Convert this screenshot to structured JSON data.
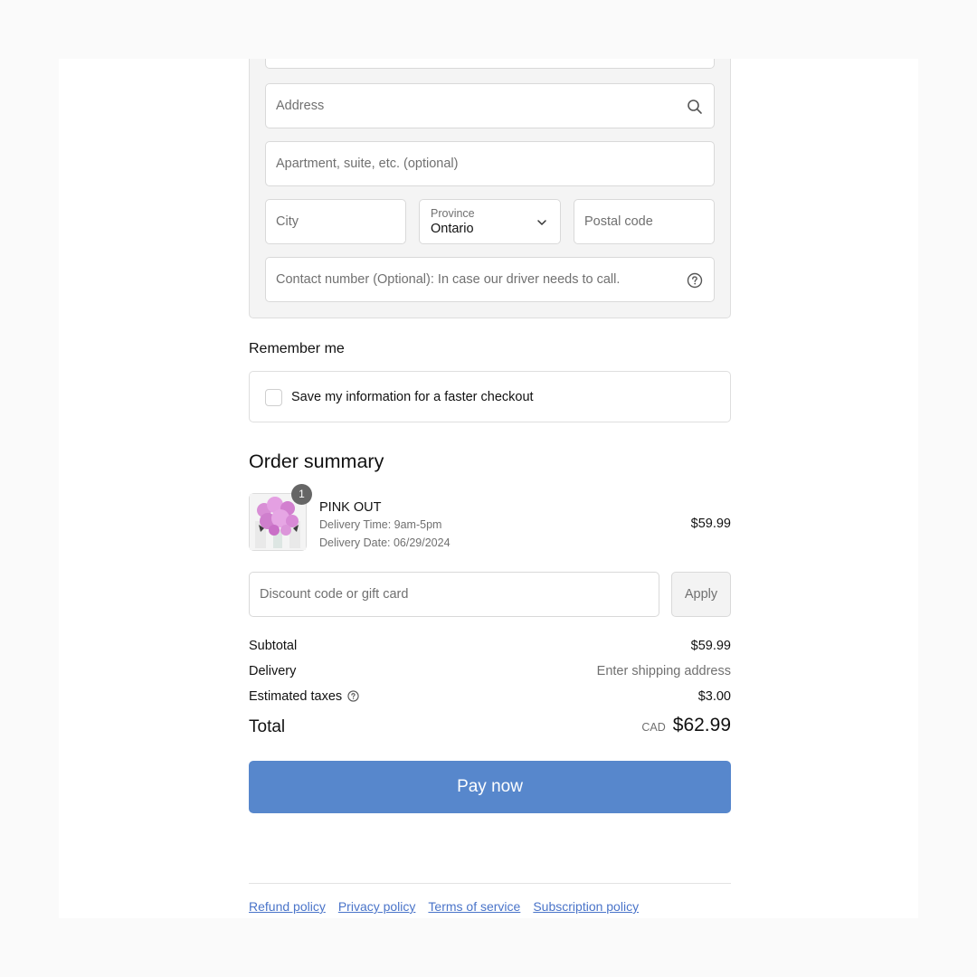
{
  "address_form": {
    "address_placeholder": "Address",
    "apartment_placeholder": "Apartment, suite, etc. (optional)",
    "city_placeholder": "City",
    "province_label": "Province",
    "province_value": "Ontario",
    "postal_placeholder": "Postal code",
    "contact_placeholder": "Contact number (Optional): In case our driver needs to call."
  },
  "remember": {
    "heading": "Remember me",
    "checkbox_label": "Save my information for a faster checkout",
    "checked": false
  },
  "order_summary": {
    "heading": "Order summary",
    "item": {
      "quantity": "1",
      "name": "PINK OUT",
      "delivery_time": "Delivery Time: 9am-5pm",
      "delivery_date": "Delivery Date: 06/29/2024",
      "price": "$59.99"
    },
    "discount_placeholder": "Discount code or gift card",
    "apply_label": "Apply",
    "subtotal_label": "Subtotal",
    "subtotal_value": "$59.99",
    "delivery_label": "Delivery",
    "delivery_value": "Enter shipping address",
    "taxes_label": "Estimated taxes",
    "taxes_value": "$3.00",
    "total_label": "Total",
    "total_currency": "CAD",
    "total_value": "$62.99"
  },
  "pay_button": "Pay now",
  "footer": {
    "links": [
      "Refund policy",
      "Privacy policy",
      "Terms of service",
      "Subscription policy"
    ]
  },
  "colors": {
    "accent": "#5787cc",
    "link": "#4a74c9",
    "badge": "#666666"
  }
}
